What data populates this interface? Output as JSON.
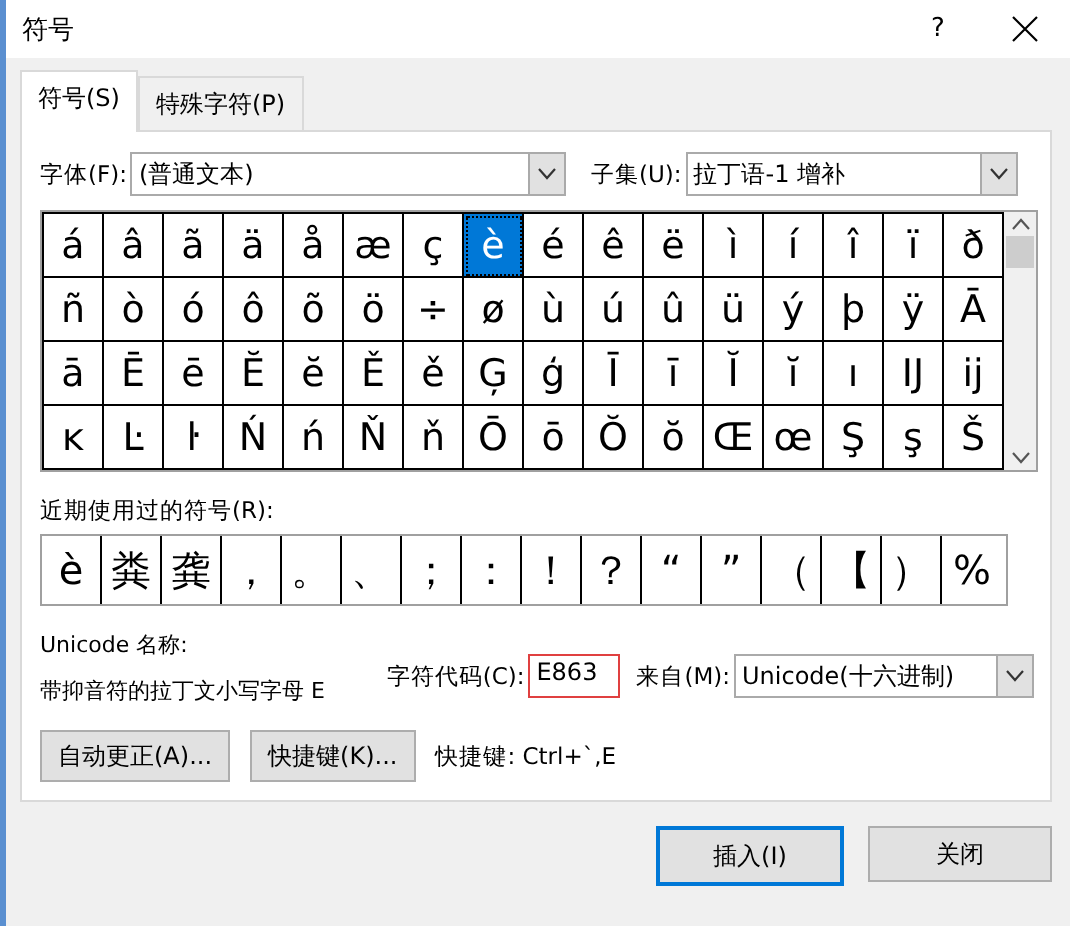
{
  "window": {
    "title": "符号",
    "help": "?"
  },
  "tabs": [
    {
      "label": "符号(S)",
      "selected": true
    },
    {
      "label": "特殊字符(P)",
      "selected": false
    }
  ],
  "font": {
    "label": "字体(F):",
    "value": "(普通文本)"
  },
  "subset": {
    "label": "子集(U):",
    "value": "拉丁语-1 增补"
  },
  "symbols": [
    {
      "char": "á",
      "selected": false
    },
    {
      "char": "â",
      "selected": false
    },
    {
      "char": "ã",
      "selected": false
    },
    {
      "char": "ä",
      "selected": false
    },
    {
      "char": "å",
      "selected": false
    },
    {
      "char": "æ",
      "selected": false
    },
    {
      "char": "ç",
      "selected": false
    },
    {
      "char": "è",
      "selected": true
    },
    {
      "char": "é",
      "selected": false
    },
    {
      "char": "ê",
      "selected": false
    },
    {
      "char": "ë",
      "selected": false
    },
    {
      "char": "ì",
      "selected": false
    },
    {
      "char": "í",
      "selected": false
    },
    {
      "char": "î",
      "selected": false
    },
    {
      "char": "ï",
      "selected": false
    },
    {
      "char": "ð",
      "selected": false
    },
    {
      "char": "ñ",
      "selected": false
    },
    {
      "char": "ò",
      "selected": false
    },
    {
      "char": "ó",
      "selected": false
    },
    {
      "char": "ô",
      "selected": false
    },
    {
      "char": "õ",
      "selected": false
    },
    {
      "char": "ö",
      "selected": false
    },
    {
      "char": "÷",
      "selected": false
    },
    {
      "char": "ø",
      "selected": false
    },
    {
      "char": "ù",
      "selected": false
    },
    {
      "char": "ú",
      "selected": false
    },
    {
      "char": "û",
      "selected": false
    },
    {
      "char": "ü",
      "selected": false
    },
    {
      "char": "ý",
      "selected": false
    },
    {
      "char": "þ",
      "selected": false
    },
    {
      "char": "ÿ",
      "selected": false
    },
    {
      "char": "Ā",
      "selected": false
    },
    {
      "char": "ā",
      "selected": false
    },
    {
      "char": "Ē",
      "selected": false
    },
    {
      "char": "ē",
      "selected": false
    },
    {
      "char": "Ĕ",
      "selected": false
    },
    {
      "char": "ĕ",
      "selected": false
    },
    {
      "char": "Ě",
      "selected": false
    },
    {
      "char": "ě",
      "selected": false
    },
    {
      "char": "Ģ",
      "selected": false
    },
    {
      "char": "ģ",
      "selected": false
    },
    {
      "char": "Ī",
      "selected": false
    },
    {
      "char": "ī",
      "selected": false
    },
    {
      "char": "Ĭ",
      "selected": false
    },
    {
      "char": "ĭ",
      "selected": false
    },
    {
      "char": "ı",
      "selected": false
    },
    {
      "char": "Ĳ",
      "selected": false
    },
    {
      "char": "ĳ",
      "selected": false
    },
    {
      "char": "ĸ",
      "selected": false
    },
    {
      "char": "Ŀ",
      "selected": false
    },
    {
      "char": "ŀ",
      "selected": false
    },
    {
      "char": "Ń",
      "selected": false
    },
    {
      "char": "ń",
      "selected": false
    },
    {
      "char": "Ň",
      "selected": false
    },
    {
      "char": "ň",
      "selected": false
    },
    {
      "char": "Ō",
      "selected": false
    },
    {
      "char": "ō",
      "selected": false
    },
    {
      "char": "Ŏ",
      "selected": false
    },
    {
      "char": "ŏ",
      "selected": false
    },
    {
      "char": "Œ",
      "selected": false
    },
    {
      "char": "œ",
      "selected": false
    },
    {
      "char": "Ş",
      "selected": false
    },
    {
      "char": "ş",
      "selected": false
    },
    {
      "char": "Š",
      "selected": false
    }
  ],
  "recent": {
    "label": "近期使用过的符号(R):",
    "symbols": [
      "è",
      "粪",
      "龚",
      "，",
      "。",
      "、",
      "；",
      "：",
      "！",
      "？",
      "“",
      "”",
      "（",
      "【",
      "）",
      "%"
    ]
  },
  "unicode_name": {
    "label": "Unicode 名称:",
    "value": "带抑音符的拉丁文小写字母 E"
  },
  "char_code": {
    "label": "字符代码(C):",
    "value": "E863"
  },
  "from": {
    "label": "来自(M):",
    "value": "Unicode(十六进制)"
  },
  "actions": [
    "自动更正(A)...",
    "快捷键(K)..."
  ],
  "shortcut": "快捷键: Ctrl+`,E",
  "buttons": [
    {
      "label": "插入(I)",
      "default": true
    },
    {
      "label": "关闭",
      "default": false
    }
  ]
}
